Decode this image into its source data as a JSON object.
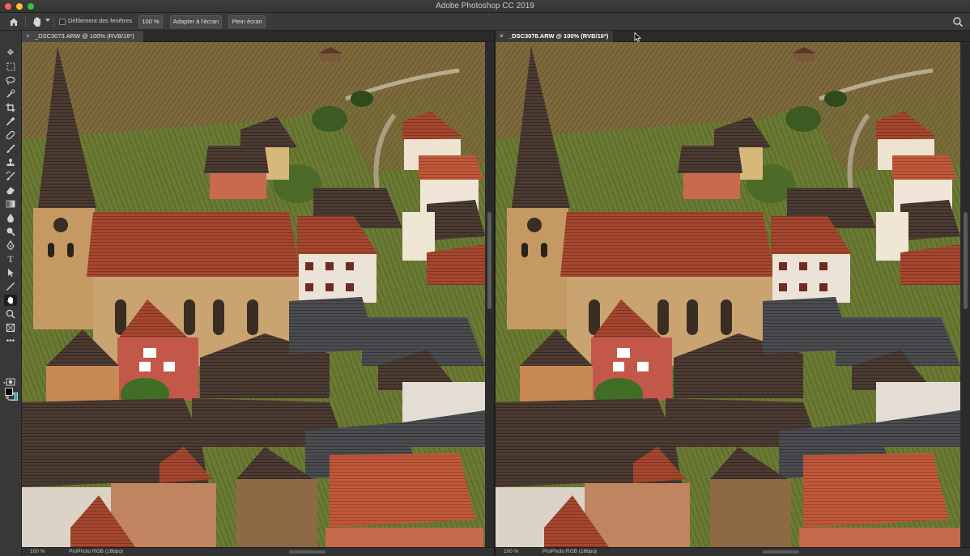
{
  "app": {
    "title": "Adobe Photoshop CC 2019"
  },
  "options_bar": {
    "tool_icon": "hand-icon",
    "scroll_all_windows_label": "Défilement des fenêtres",
    "scroll_all_windows_checked": false,
    "zoom_100_label": "100 %",
    "fit_screen_label": "Adapter à l'écran",
    "fill_screen_label": "Plein écran"
  },
  "toolbar": {
    "tools": [
      {
        "name": "move-tool",
        "icon": "move-icon"
      },
      {
        "name": "marquee-tool",
        "icon": "marquee-icon"
      },
      {
        "name": "lasso-tool",
        "icon": "lasso-icon"
      },
      {
        "name": "quick-selection-tool",
        "icon": "quick-selection-icon"
      },
      {
        "name": "crop-tool",
        "icon": "crop-icon"
      },
      {
        "name": "eyedropper-tool",
        "icon": "eyedropper-icon"
      },
      {
        "name": "healing-brush-tool",
        "icon": "bandage-icon"
      },
      {
        "name": "brush-tool",
        "icon": "brush-icon"
      },
      {
        "name": "clone-stamp-tool",
        "icon": "stamp-icon"
      },
      {
        "name": "history-brush-tool",
        "icon": "history-brush-icon"
      },
      {
        "name": "eraser-tool",
        "icon": "eraser-icon"
      },
      {
        "name": "gradient-tool",
        "icon": "gradient-icon"
      },
      {
        "name": "blur-tool",
        "icon": "drop-icon"
      },
      {
        "name": "dodge-tool",
        "icon": "dodge-icon"
      },
      {
        "name": "pen-tool",
        "icon": "pen-icon"
      },
      {
        "name": "type-tool",
        "icon": "type-icon"
      },
      {
        "name": "path-selection-tool",
        "icon": "arrow-icon"
      },
      {
        "name": "line-tool",
        "icon": "line-icon"
      },
      {
        "name": "hand-tool",
        "icon": "hand-icon",
        "active": true
      },
      {
        "name": "zoom-tool",
        "icon": "zoom-icon"
      },
      {
        "name": "frame-tool",
        "icon": "frame-icon"
      },
      {
        "name": "more-tools",
        "icon": "ellipsis-icon"
      }
    ],
    "foreground_color": "#000000",
    "background_color": "#19a6c9"
  },
  "documents": [
    {
      "tab_label": "_DSC3073.ARW @ 100% (RVB/16*)",
      "active": false,
      "zoom": "100 %",
      "profile": "ProPhoto RGB (16bpc)"
    },
    {
      "tab_label": "_DSC3078.ARW @ 100% (RVB/16*)",
      "active": true,
      "zoom": "100 %",
      "profile": "ProPhoto RGB (16bpc)"
    }
  ],
  "colors": {
    "chrome_dark": "#2b2b2b",
    "panel": "#383838",
    "accent_bg_swatch": "#19a6c9"
  }
}
